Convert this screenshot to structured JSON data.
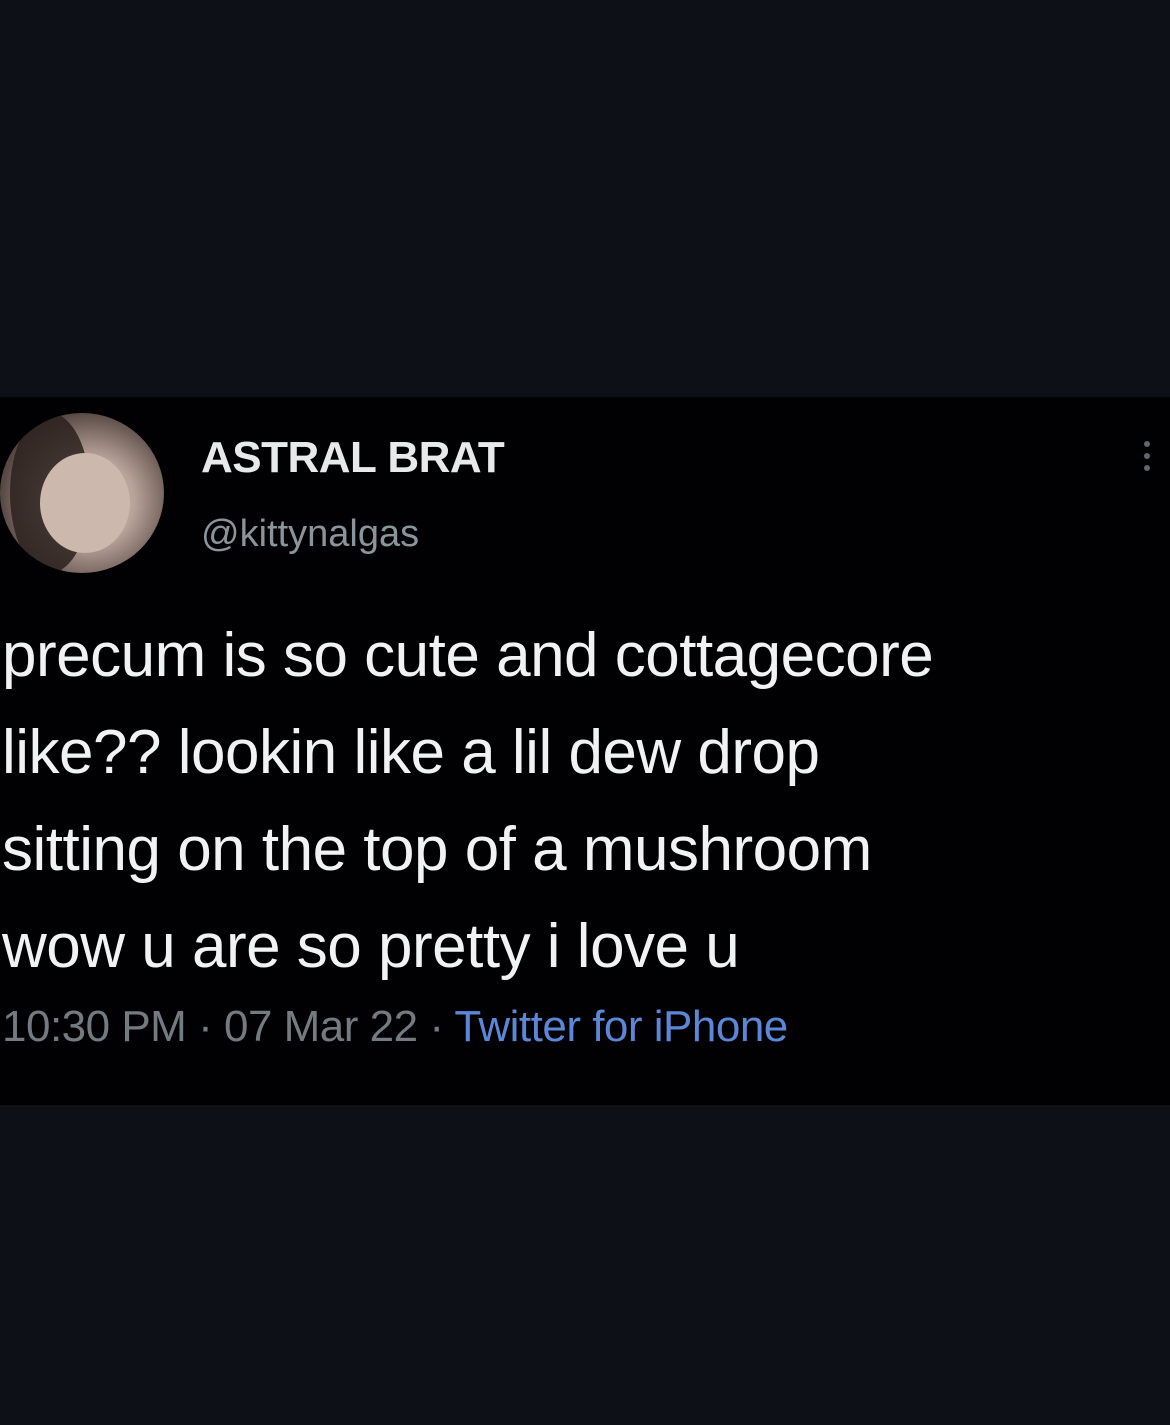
{
  "tweet": {
    "display_name": "ASTRAL BRAT",
    "handle": "@kittynalgas",
    "lines": [
      "precum is so cute and cottagecore",
      "like?? lookin like a lil dew drop",
      "sitting on the top of a mushroom",
      "wow u are so pretty i love u"
    ],
    "time": "10:30 PM",
    "separator": "·",
    "date": "07 Mar 22",
    "source": "Twitter for iPhone"
  },
  "icons": {
    "avatar": "avatar-photo",
    "more": "more-options-icon"
  },
  "colors": {
    "background": "#0d1117",
    "card": "#010103",
    "text": "#f1f2f3",
    "muted": "#737a80",
    "link": "#5c86d6"
  }
}
